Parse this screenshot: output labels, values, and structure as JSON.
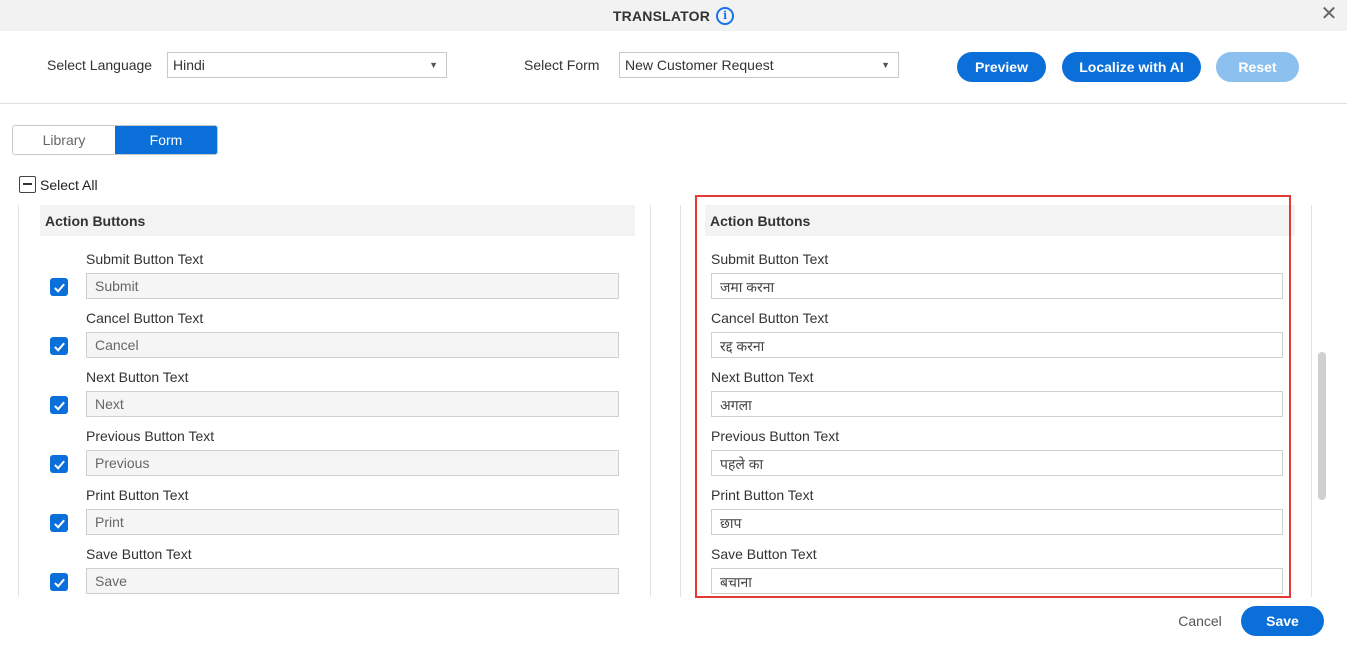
{
  "window": {
    "title": "TRANSLATOR",
    "info_icon": "info-icon",
    "close_icon": "close-icon"
  },
  "toolbar": {
    "language_label": "Select Language",
    "language_value": "Hindi",
    "form_label": "Select Form",
    "form_value": "New Customer Request",
    "preview_label": "Preview",
    "localize_label": "Localize with AI",
    "reset_label": "Reset"
  },
  "tabs": [
    {
      "label": "Library",
      "active": false
    },
    {
      "label": "Form",
      "active": true
    }
  ],
  "select_all_label": "Select All",
  "source": {
    "section_title": "Action Buttons",
    "fields": [
      {
        "label": "Submit Button Text",
        "value": "Submit",
        "checked": true
      },
      {
        "label": "Cancel Button Text",
        "value": "Cancel",
        "checked": true
      },
      {
        "label": "Next Button Text",
        "value": "Next",
        "checked": true
      },
      {
        "label": "Previous Button Text",
        "value": "Previous",
        "checked": true
      },
      {
        "label": "Print Button Text",
        "value": "Print",
        "checked": true
      },
      {
        "label": "Save Button Text",
        "value": "Save",
        "checked": true
      }
    ]
  },
  "target": {
    "section_title": "Action Buttons",
    "fields": [
      {
        "label": "Submit Button Text",
        "value": "जमा करना"
      },
      {
        "label": "Cancel Button Text",
        "value": "रद्द करना"
      },
      {
        "label": "Next Button Text",
        "value": "अगला"
      },
      {
        "label": "Previous Button Text",
        "value": "पहले का"
      },
      {
        "label": "Print Button Text",
        "value": "छाप"
      },
      {
        "label": "Save Button Text",
        "value": "बचाना"
      }
    ]
  },
  "footer": {
    "cancel_label": "Cancel",
    "save_label": "Save"
  },
  "colors": {
    "primary": "#0a6fd8",
    "disabled": "#8cc0ee",
    "highlight": "#e53935"
  }
}
